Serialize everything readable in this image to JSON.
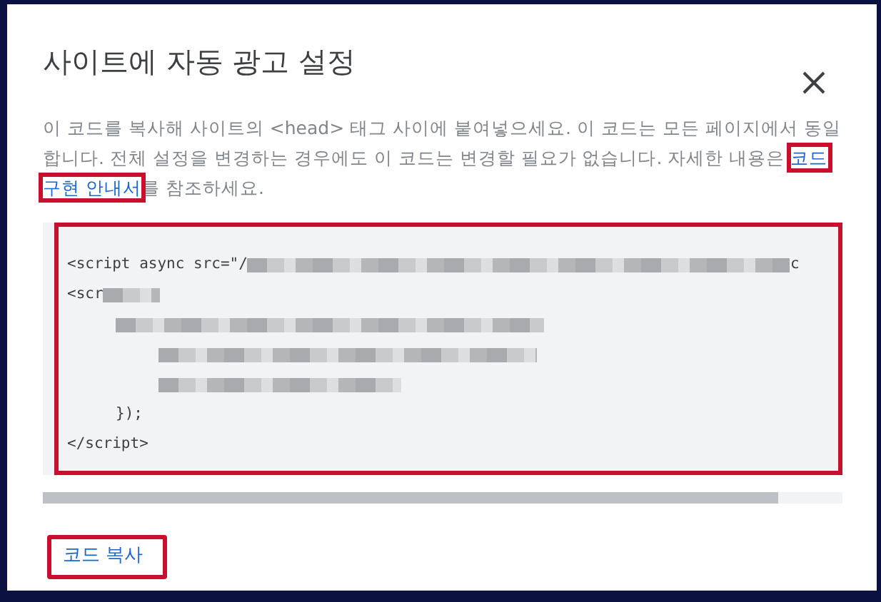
{
  "dialog": {
    "title": "사이트에 자동 광고 설정",
    "description": {
      "before": "이 코드를 복사해 사이트의 <head> 태그 사이에 붙여넣으세요. 이 코드는 모든 페이지에서 동일합니다. 전체 설정을 변경하는 경우에도 이 코드는 변경할 필요가 없습니다. 자세한 내용은 ",
      "link_lines": [
        "코드",
        "구현 안내서"
      ],
      "after": "를 참조하세요."
    },
    "code_lines": [
      {
        "parts": [
          {
            "kind": "text",
            "text": "<script async src=\"/"
          },
          {
            "kind": "redacted"
          },
          {
            "kind": "text",
            "text": "c"
          }
        ]
      },
      {
        "parts": [
          {
            "kind": "text",
            "text": "<scr"
          },
          {
            "kind": "redacted"
          }
        ],
        "children": [
          {
            "parts": [
              {
                "kind": "redacted"
              }
            ],
            "children": [
              {
                "parts": [
                  {
                    "kind": "redacted"
                  }
                ]
              },
              {
                "parts": [
                  {
                    "kind": "redacted"
                  }
                ]
              }
            ]
          },
          {
            "parts": [
              {
                "kind": "text",
                "text": "});"
              }
            ]
          }
        ]
      },
      {
        "parts": [
          {
            "kind": "text",
            "text": "</script>"
          }
        ]
      }
    ],
    "copy_button": "코드 복사"
  }
}
